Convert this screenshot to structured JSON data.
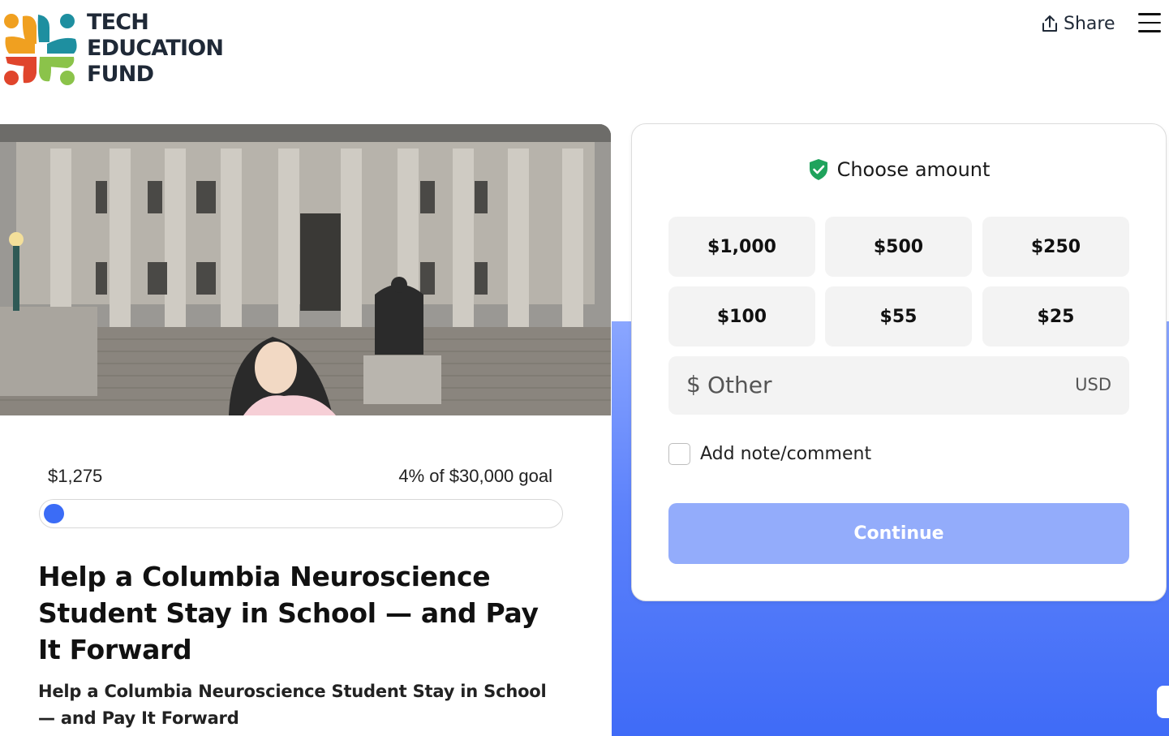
{
  "brand": {
    "name_lines": [
      "TECH",
      "EDUCATION",
      "FUND"
    ],
    "colors": [
      "#f0a020",
      "#1e8fa0",
      "#e0452c",
      "#8bc34a"
    ]
  },
  "header": {
    "share_label": "Share",
    "share_icon": "share-upload-icon",
    "menu_icon": "hamburger-menu-icon"
  },
  "hero": {
    "image_subject": "campus-building-photo"
  },
  "campaign": {
    "raised": "$1,275",
    "goal_text": "4% of $30,000 goal",
    "progress_fraction": 0.04,
    "title": "Help a Columbia Neuroscience Student Stay in School — and Pay It Forward",
    "subtitle": "Help a Columbia Neuroscience Student Stay in School — and Pay It Forward"
  },
  "donation": {
    "heading": "Choose amount",
    "heading_icon": "shield-check-icon",
    "amounts": [
      "$1,000",
      "$500",
      "$250",
      "$100",
      "$55",
      "$25"
    ],
    "other": {
      "currency_symbol": "$",
      "placeholder": "Other",
      "currency_code": "USD"
    },
    "note_label": "Add note/comment",
    "continue_label": "Continue"
  },
  "colors": {
    "accent": "#3b6cf6",
    "continue_disabled": "#93acfb"
  }
}
